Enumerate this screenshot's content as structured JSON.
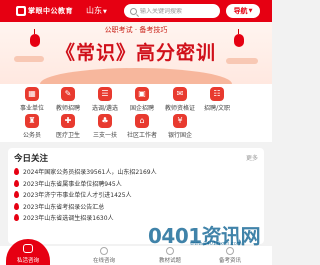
{
  "header": {
    "logo_text": "掌眼中公教育",
    "region": "山东",
    "region_caret": "▼",
    "search_placeholder": "输入关键词搜索",
    "nav_label": "导航",
    "nav_caret": "▼"
  },
  "banner": {
    "subtitle": "公职考试 · 备考技巧",
    "title": "《常识》高分密训"
  },
  "quick_links": [
    {
      "label": "事业单位",
      "icon": "building-icon",
      "glyph": "▦"
    },
    {
      "label": "教师招聘",
      "icon": "teacher-icon",
      "glyph": "✎"
    },
    {
      "label": "选调/遴选",
      "icon": "select-icon",
      "glyph": "☰"
    },
    {
      "label": "国企招聘",
      "icon": "company-icon",
      "glyph": "▣"
    },
    {
      "label": "教师资格证",
      "icon": "certificate-icon",
      "glyph": "✉"
    },
    {
      "label": "招聘/文职",
      "icon": "job-icon",
      "glyph": "☷"
    },
    {
      "label": "公务员",
      "icon": "civil-servant-icon",
      "glyph": "♜"
    },
    {
      "label": "医疗卫生",
      "icon": "medical-icon",
      "glyph": "✚"
    },
    {
      "label": "三支一扶",
      "icon": "support-icon",
      "glyph": "♣"
    },
    {
      "label": "社区工作者",
      "icon": "community-icon",
      "glyph": "⌂"
    },
    {
      "label": "银行国企",
      "icon": "bank-icon",
      "glyph": "¥"
    }
  ],
  "today": {
    "title": "今日关注",
    "more_label": "更多",
    "items": [
      "2024年国家公务员招录39561人，山东招2169人",
      "2023年山东省属事业单位招聘945人",
      "2023年济宁市事业单位人才引进1425人",
      "2023年山东省考招录公告汇总",
      "2023年山东省选调生招录1630人"
    ]
  },
  "bottom_nav": [
    {
      "label": "私活咨询",
      "icon": "chat-icon",
      "active": true
    },
    {
      "label": "在线咨询",
      "icon": "online-icon",
      "active": false
    },
    {
      "label": "教材试题",
      "icon": "book-icon",
      "active": false
    },
    {
      "label": "备考资讯",
      "icon": "news-icon",
      "active": false
    }
  ],
  "watermark": {
    "text": "0401资讯网",
    "sub": "www.0401zixun.com"
  },
  "colors": {
    "brand": "#e60012",
    "icon_bg": "#e83a2f",
    "page_bg": "#f2f2f2"
  }
}
